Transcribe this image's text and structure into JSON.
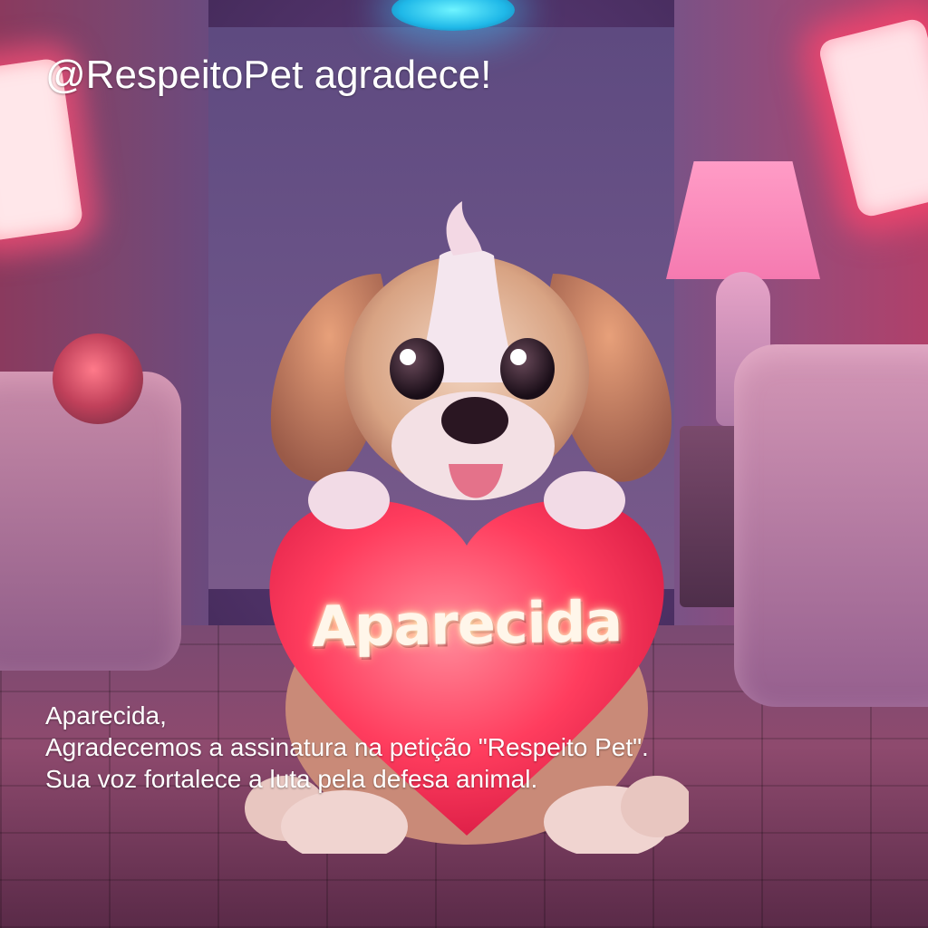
{
  "header": {
    "title": "@RespeitoPet agradece!"
  },
  "heart": {
    "name": "Aparecida"
  },
  "message": {
    "greeting": "Aparecida,",
    "line1": "Agradecemos a assinatura na petição \"Respeito Pet\".",
    "line2": "Sua voz fortalece a luta pela defesa animal."
  },
  "icons": [
    "dog-illustration",
    "heart-icon",
    "neon-sign",
    "lamp",
    "sofa"
  ],
  "colors": {
    "heart": "#ff3d5e",
    "neon": "#ff4a7a",
    "ceiling_light": "#3fd6ff",
    "text": "#ffffff"
  }
}
